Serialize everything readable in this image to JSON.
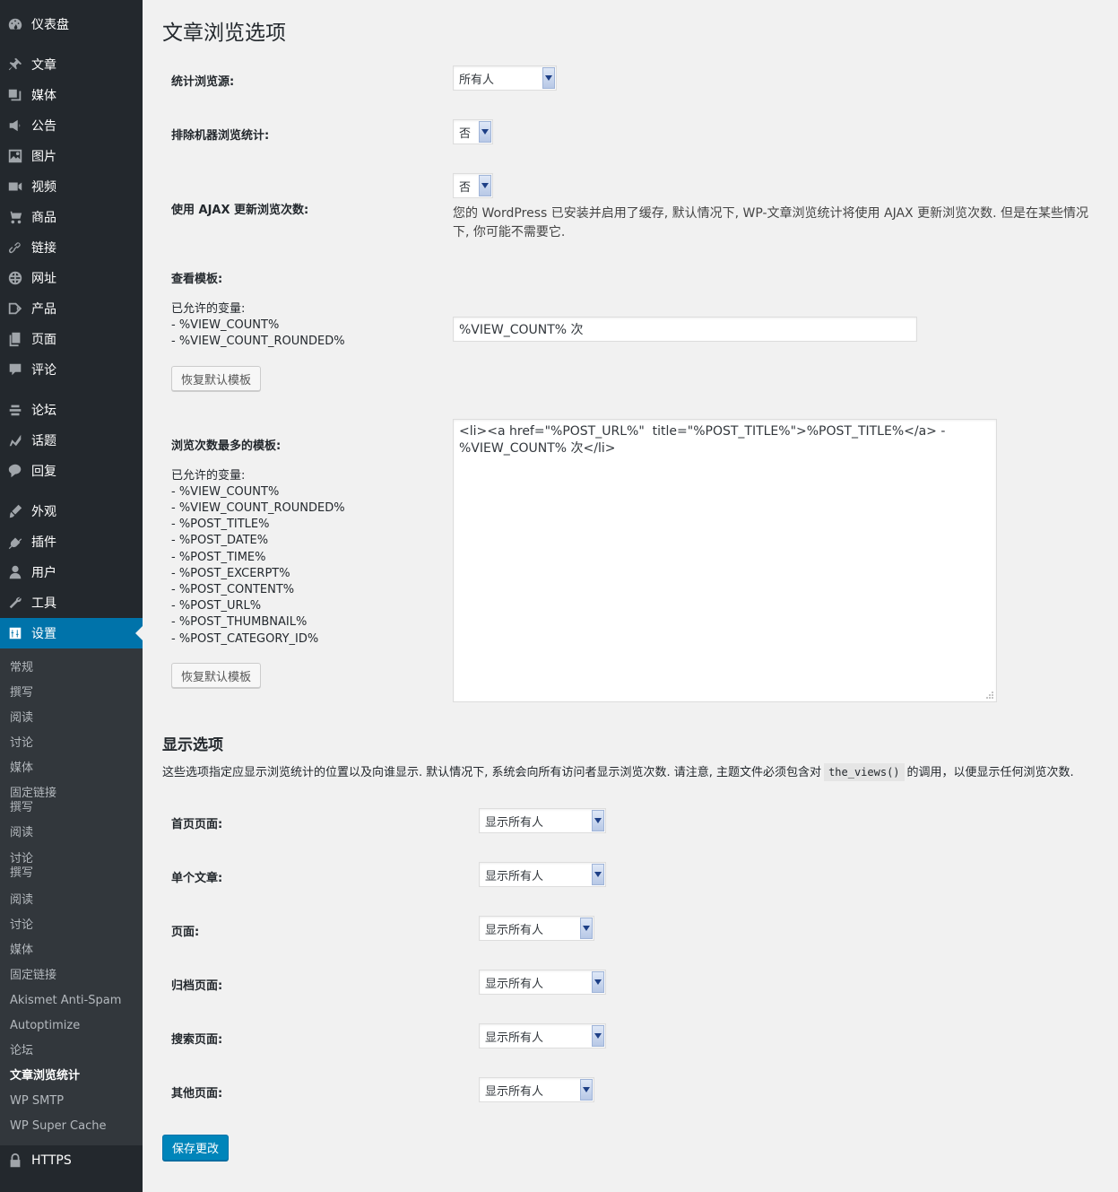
{
  "sidebar": {
    "menu": [
      {
        "label": "仪表盘",
        "icon": "dashboard-icon"
      },
      {
        "label": "文章",
        "icon": "pin-icon"
      },
      {
        "label": "媒体",
        "icon": "media-icon"
      },
      {
        "label": "公告",
        "icon": "megaphone-icon"
      },
      {
        "label": "图片",
        "icon": "image-icon"
      },
      {
        "label": "视频",
        "icon": "video-icon"
      },
      {
        "label": "商品",
        "icon": "cart-icon"
      },
      {
        "label": "链接",
        "icon": "link-icon"
      },
      {
        "label": "网址",
        "icon": "globe-icon"
      },
      {
        "label": "产品",
        "icon": "product-icon"
      },
      {
        "label": "页面",
        "icon": "page-icon"
      },
      {
        "label": "评论",
        "icon": "comment-icon"
      },
      {
        "label": "论坛",
        "icon": "forum-icon"
      },
      {
        "label": "话题",
        "icon": "topic-icon"
      },
      {
        "label": "回复",
        "icon": "reply-icon"
      },
      {
        "label": "外观",
        "icon": "brush-icon"
      },
      {
        "label": "插件",
        "icon": "plugin-icon"
      },
      {
        "label": "用户",
        "icon": "user-icon"
      },
      {
        "label": "工具",
        "icon": "wrench-icon"
      },
      {
        "label": "设置",
        "icon": "settings-icon"
      },
      {
        "label": "HTTPS",
        "icon": "lock-icon"
      }
    ],
    "submenu": [
      "常规",
      "撰写",
      "阅读",
      "讨论",
      "媒体",
      "固定链接",
      "撰写",
      "阅读",
      "讨论",
      "撰写",
      "阅读",
      "讨论",
      "媒体",
      "固定链接",
      "Akismet Anti-Spam",
      "Autoptimize",
      "论坛",
      "文章浏览统计",
      "WP SMTP",
      "WP Super Cache"
    ]
  },
  "page": {
    "title": "文章浏览选项",
    "count_source": {
      "label": "统计浏览源:",
      "value": "所有人"
    },
    "exclude_bots": {
      "label": "排除机器浏览统计:",
      "value": "否"
    },
    "use_ajax": {
      "label": "使用 AJAX 更新浏览次数:",
      "value": "否",
      "description_line1": "您的 WordPress 已安装并启用了缓存, 默认情况下, WP-文章浏览统计将使用 AJAX 更新浏览次数. 但是在某些情况",
      "description_line2": "下, 你可能不需要它."
    },
    "view_template": {
      "label": "查看模板:",
      "vars_title": "已允许的变量:",
      "vars": [
        "- %VIEW_COUNT%",
        "- %VIEW_COUNT_ROUNDED%"
      ],
      "value": "%VIEW_COUNT% 次",
      "reset_label": "恢复默认模板"
    },
    "most_viewed_template": {
      "label": "浏览次数最多的模板:",
      "vars_title": "已允许的变量:",
      "vars": [
        "- %VIEW_COUNT%",
        "- %VIEW_COUNT_ROUNDED%",
        "- %POST_TITLE%",
        "- %POST_DATE%",
        "- %POST_TIME%",
        "- %POST_EXCERPT%",
        "- %POST_CONTENT%",
        "- %POST_URL%",
        "- %POST_THUMBNAIL%",
        "- %POST_CATEGORY_ID%"
      ],
      "value": "<li><a href=\"%POST_URL%\"  title=\"%POST_TITLE%\">%POST_TITLE%</a> - %VIEW_COUNT% 次</li>",
      "reset_label": "恢复默认模板"
    },
    "display_section": {
      "title": "显示选项",
      "desc_before": "这些选项指定应显示浏览统计的位置以及向谁显示. 默认情况下, 系统会向所有访问者显示浏览次数. 请注意, 主题文件必须包含对",
      "code": "the_views()",
      "desc_after": "的调用，以便显示任何浏览次数.",
      "rows": [
        {
          "label": "首页页面:",
          "value": "显示所有人"
        },
        {
          "label": "单个文章:",
          "value": "显示所有人"
        },
        {
          "label": "页面:",
          "value": "显示所有人"
        },
        {
          "label": "归档页面:",
          "value": "显示所有人"
        },
        {
          "label": "搜索页面:",
          "value": "显示所有人"
        },
        {
          "label": "其他页面:",
          "value": "显示所有人"
        }
      ]
    },
    "save_label": "保存更改"
  },
  "colors": {
    "sidebar_bg": "#23282d",
    "submenu_bg": "#32373c",
    "active_bg": "#0073aa",
    "primary_button": "#0085ba",
    "page_bg": "#f1f1f1"
  }
}
